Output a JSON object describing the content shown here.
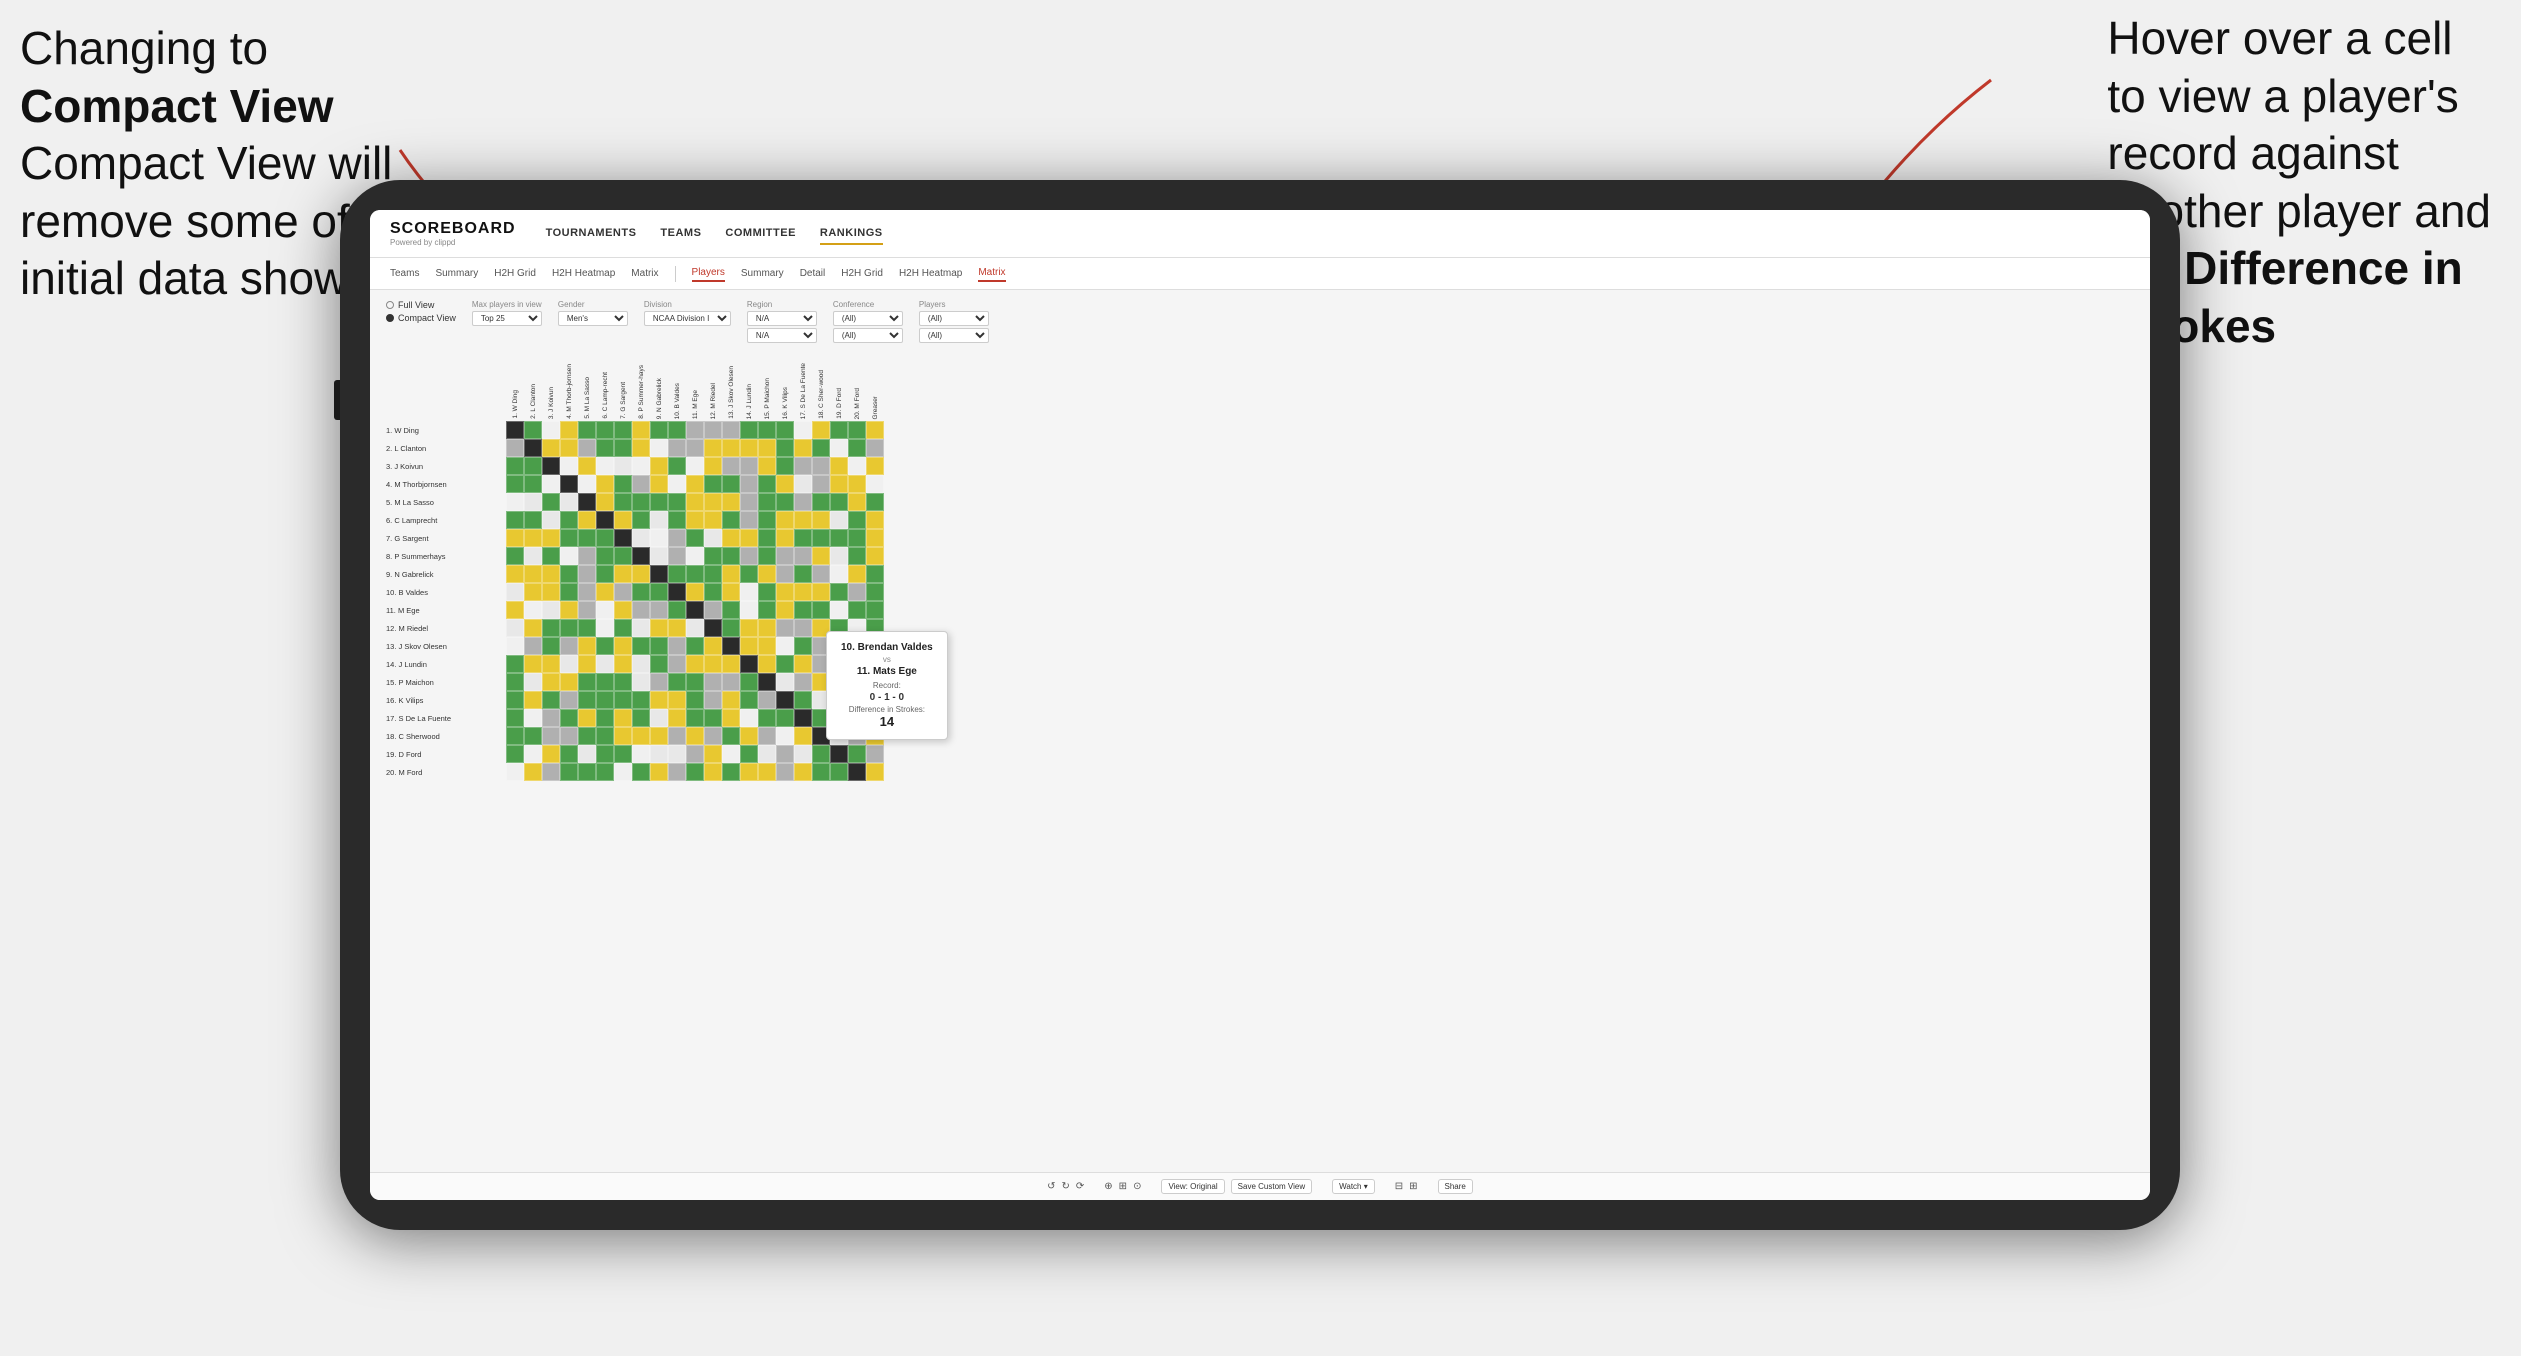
{
  "annotations": {
    "left": {
      "line1": "Changing to",
      "line2": "Compact View will",
      "line3": "remove some of the",
      "line4": "initial data shown"
    },
    "right": {
      "line1": "Hover over a cell",
      "line2": "to view a player's",
      "line3": "record against",
      "line4": "another player and",
      "line5": "the ",
      "line5bold": "Difference in",
      "line6bold": "Strokes"
    }
  },
  "navbar": {
    "logo": "SCOREBOARD",
    "logo_sub": "Powered by clippd",
    "items": [
      "TOURNAMENTS",
      "TEAMS",
      "COMMITTEE",
      "RANKINGS"
    ]
  },
  "subnav": {
    "group1": [
      "Teams",
      "Summary",
      "H2H Grid",
      "H2H Heatmap",
      "Matrix"
    ],
    "group2": [
      "Players",
      "Summary",
      "Detail",
      "H2H Grid",
      "H2H Heatmap",
      "Matrix"
    ]
  },
  "filters": {
    "view_options": [
      "Full View",
      "Compact View"
    ],
    "selected_view": "Compact View",
    "max_players_label": "Max players in view",
    "max_players_value": "Top 25",
    "gender_label": "Gender",
    "gender_value": "Men's",
    "division_label": "Division",
    "division_value": "NCAA Division I",
    "region_label": "Region",
    "region_value": "N/A",
    "conference_label": "Conference",
    "conference_value": "(All)",
    "players_label": "Players",
    "players_value": "(All)"
  },
  "row_players": [
    "1. W Ding",
    "2. L Clanton",
    "3. J Koivun",
    "4. M Thorbjornsen",
    "5. M La Sasso",
    "6. C Lamprecht",
    "7. G Sargent",
    "8. P Summerhays",
    "9. N Gabrelick",
    "10. B Valdes",
    "11. M Ege",
    "12. M Riedel",
    "13. J Skov Olesen",
    "14. J Lundin",
    "15. P Maichon",
    "16. K Vilips",
    "17. S De La Fuente",
    "18. C Sherwood",
    "19. D Ford",
    "20. M Ford"
  ],
  "col_players": [
    "1. W Ding",
    "2. L Clanton",
    "3. J Koivun",
    "4. M Thorb-jornsen",
    "5. M La Sasso",
    "6. C Lamp-recht",
    "7. G Sargent",
    "8. P Summer-hays",
    "9. N Gabrelick",
    "10. B Valdes",
    "11. M Ege",
    "12. M Riedel",
    "13. J Skov Olesen",
    "14. J Lundin",
    "15. P Maichon",
    "16. K Vilips",
    "17. S De La Fuente",
    "18. C Sher-wood",
    "19. D Ford",
    "20. M Ford",
    "Greaser"
  ],
  "tooltip": {
    "player1": "10. Brendan Valdes",
    "vs": "vs",
    "player2": "11. Mats Ege",
    "record_label": "Record:",
    "record": "0 - 1 - 0",
    "diff_label": "Difference in Strokes:",
    "diff_value": "14"
  },
  "toolbar": {
    "view_label": "View: Original",
    "save_custom": "Save Custom View",
    "watch": "Watch ▾",
    "share": "Share"
  }
}
